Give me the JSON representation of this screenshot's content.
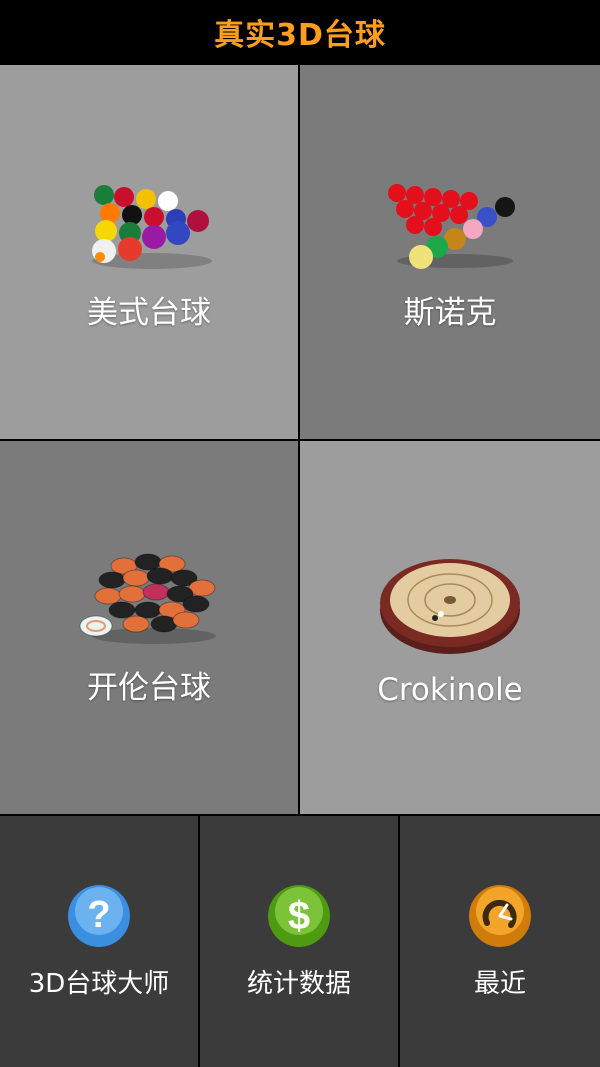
{
  "header": {
    "title": "真实3D台球"
  },
  "tiles": [
    {
      "label": "美式台球",
      "icon": "pool-balls-rack-icon"
    },
    {
      "label": "斯诺克",
      "icon": "snooker-balls-icon"
    },
    {
      "label": "开伦台球",
      "icon": "carrom-pieces-icon"
    },
    {
      "label": "Crokinole",
      "icon": "crokinole-board-icon"
    }
  ],
  "bottom": [
    {
      "label": "3D台球大师",
      "icon": "question-mark-icon",
      "color": "#3a8fe0"
    },
    {
      "label": "统计数据",
      "icon": "dollar-sign-icon",
      "color": "#5aa818"
    },
    {
      "label": "最近",
      "icon": "clock-icon",
      "color": "#e08a10"
    }
  ],
  "colors": {
    "title": "#ff9e1b",
    "header_bg": "#000000"
  }
}
